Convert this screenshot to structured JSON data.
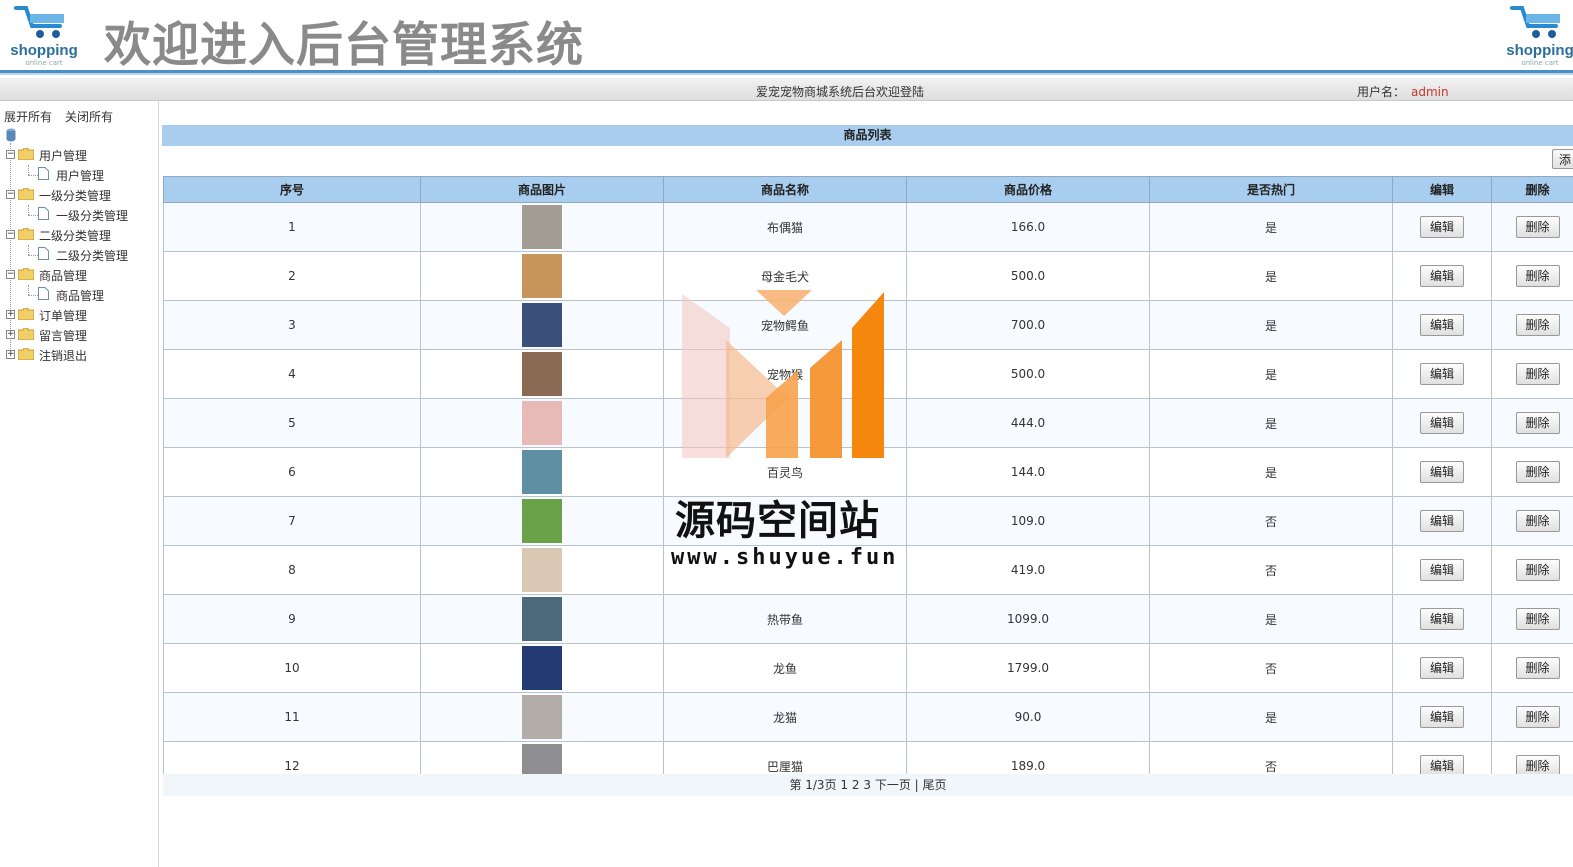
{
  "header": {
    "logo_word": "shopping",
    "logo_sub": "online cart",
    "title": "欢迎进入后台管理系统"
  },
  "welcome": {
    "message": "爱宠宠物商城系统后台欢迎登陆",
    "user_label": "用户名：",
    "user_name": "admin"
  },
  "sidebar": {
    "expand_all": "展开所有",
    "collapse_all": "关闭所有",
    "groups": [
      {
        "label": "用户管理",
        "child": "用户管理",
        "expanded": true
      },
      {
        "label": "一级分类管理",
        "child": "一级分类管理",
        "expanded": true
      },
      {
        "label": "二级分类管理",
        "child": "二级分类管理",
        "expanded": true
      },
      {
        "label": "商品管理",
        "child": "商品管理",
        "expanded": true
      },
      {
        "label": "订单管理",
        "expanded": false
      },
      {
        "label": "留言管理",
        "expanded": false
      },
      {
        "label": "注销退出",
        "expanded": false
      }
    ]
  },
  "main": {
    "list_title": "商品列表",
    "add_button": "添",
    "columns": [
      "序号",
      "商品图片",
      "商品名称",
      "商品价格",
      "是否热门",
      "编辑",
      "删除"
    ],
    "edit_label": "编辑",
    "delete_label": "删除",
    "rows": [
      {
        "no": "1",
        "name": "布偶猫",
        "price": "166.0",
        "hot": "是",
        "img_color": "#a39c93"
      },
      {
        "no": "2",
        "name": "母金毛犬",
        "price": "500.0",
        "hot": "是",
        "img_color": "#c7955a"
      },
      {
        "no": "3",
        "name": "宠物鳄鱼",
        "price": "700.0",
        "hot": "是",
        "img_color": "#3a4f7a"
      },
      {
        "no": "4",
        "name": "宠物猴",
        "price": "500.0",
        "hot": "是",
        "img_color": "#8a6a52"
      },
      {
        "no": "5",
        "name": "",
        "price": "444.0",
        "hot": "是",
        "img_color": "#e7b9b7"
      },
      {
        "no": "6",
        "name": "百灵鸟",
        "price": "144.0",
        "hot": "是",
        "img_color": "#5f8fa2"
      },
      {
        "no": "7",
        "name": "",
        "price": "109.0",
        "hot": "否",
        "img_color": "#6aa24a"
      },
      {
        "no": "8",
        "name": "",
        "price": "419.0",
        "hot": "否",
        "img_color": "#d9c9b4"
      },
      {
        "no": "9",
        "name": "热带鱼",
        "price": "1099.0",
        "hot": "是",
        "img_color": "#4d6a7d"
      },
      {
        "no": "10",
        "name": "龙鱼",
        "price": "1799.0",
        "hot": "否",
        "img_color": "#243a72"
      },
      {
        "no": "11",
        "name": "龙猫",
        "price": "90.0",
        "hot": "是",
        "img_color": "#b3aca8"
      },
      {
        "no": "12",
        "name": "巴厘猫",
        "price": "189.0",
        "hot": "否",
        "img_color": "#8e8e92"
      }
    ],
    "pager": {
      "page_info": "第 1/3页",
      "pages": [
        "1",
        "2",
        "3"
      ],
      "next": "下一页",
      "separator": "|",
      "last": "尾页"
    }
  },
  "watermark": {
    "title": "源码空间站",
    "url": "www.shuyue.fun"
  },
  "colors": {
    "title_bar": "#a8cdee",
    "accent_line": "#4a90c8",
    "user_name": "#c0392b",
    "wm_orange": "#f5870f"
  }
}
